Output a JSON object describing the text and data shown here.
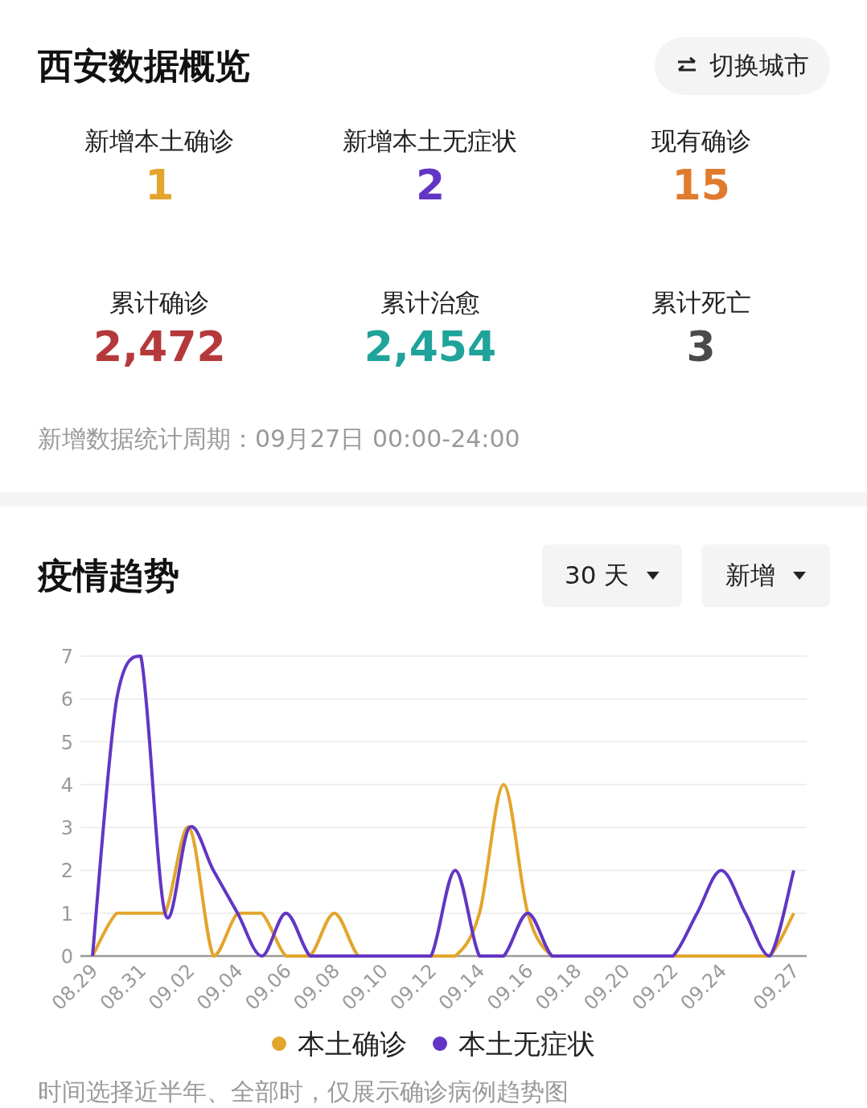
{
  "overview": {
    "title": "西安数据概览",
    "switch_button": {
      "label": "切换城市"
    },
    "stats": [
      {
        "label": "新增本土确诊",
        "value": "1",
        "color": "#e3a52c"
      },
      {
        "label": "新增本土无症状",
        "value": "2",
        "color": "#6236c4"
      },
      {
        "label": "现有确诊",
        "value": "15",
        "color": "#e07b2e"
      },
      {
        "label": "累计确诊",
        "value": "2,472",
        "color": "#b5393b"
      },
      {
        "label": "累计治愈",
        "value": "2,454",
        "color": "#1fa39a"
      },
      {
        "label": "累计死亡",
        "value": "3",
        "color": "#4a4a4a"
      }
    ],
    "period_note": "新增数据统计周期：09月27日 00:00-24:00"
  },
  "trend": {
    "title": "疫情趋势",
    "filters": [
      {
        "label": "30 天"
      },
      {
        "label": "新增"
      }
    ],
    "chart_data": {
      "type": "line",
      "categories": [
        "08.29",
        null,
        "08.31",
        null,
        "09.02",
        null,
        "09.04",
        null,
        "09.06",
        null,
        "09.08",
        null,
        "09.10",
        null,
        "09.12",
        null,
        "09.14",
        null,
        "09.16",
        null,
        "09.18",
        null,
        "09.20",
        null,
        "09.22",
        null,
        "09.24",
        null,
        null,
        "09.27"
      ],
      "grid": true,
      "series": [
        {
          "name": "本土确诊",
          "color": "#e3a52c",
          "values": [
            0,
            1,
            1,
            1,
            3,
            0,
            1,
            1,
            0,
            0,
            1,
            0,
            0,
            0,
            0,
            0,
            1,
            4,
            1,
            0,
            0,
            0,
            0,
            0,
            0,
            0,
            0,
            0,
            0,
            1
          ]
        },
        {
          "name": "本土无症状",
          "color": "#6236c4",
          "values": [
            0,
            6,
            7,
            1,
            3,
            2,
            1,
            0,
            1,
            0,
            0,
            0,
            0,
            0,
            0,
            2,
            0,
            0,
            1,
            0,
            0,
            0,
            0,
            0,
            0,
            1,
            2,
            1,
            0,
            2
          ]
        }
      ],
      "ylim": [
        0,
        7
      ],
      "yticks": [
        0,
        1,
        2,
        3,
        4,
        5,
        6,
        7
      ]
    },
    "note": "时间选择近半年、全部时，仅展示确诊病例趋势图"
  }
}
